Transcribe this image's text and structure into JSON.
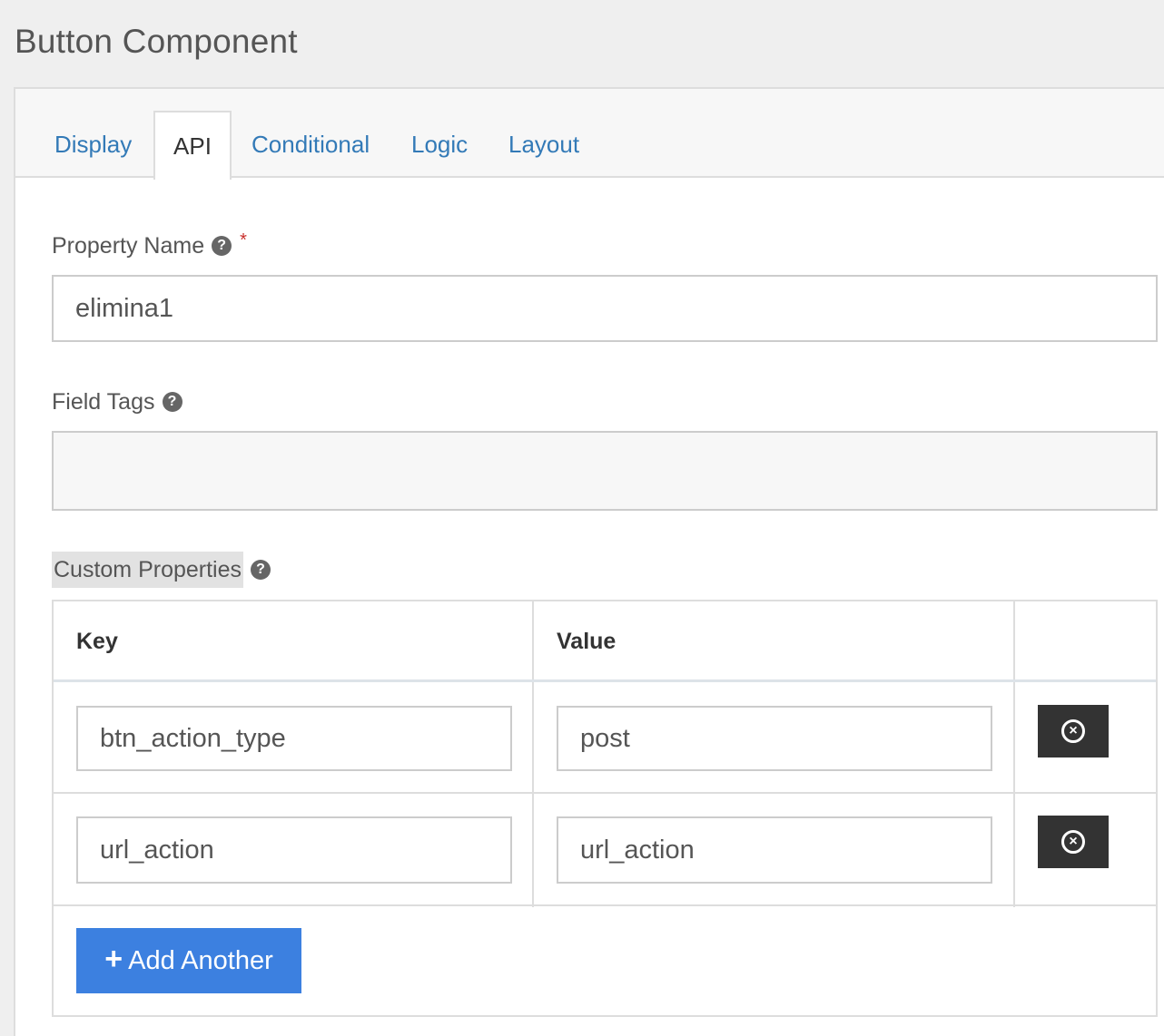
{
  "header": {
    "title": "Button Component"
  },
  "tabs": [
    {
      "label": "Display"
    },
    {
      "label": "API"
    },
    {
      "label": "Conditional"
    },
    {
      "label": "Logic"
    },
    {
      "label": "Layout"
    }
  ],
  "form": {
    "property_name": {
      "label": "Property Name",
      "required_marker": "*",
      "value": "elimina1"
    },
    "field_tags": {
      "label": "Field Tags",
      "value": ""
    },
    "custom_properties": {
      "label": "Custom Properties",
      "headers": {
        "key": "Key",
        "value": "Value"
      },
      "rows": [
        {
          "key": "btn_action_type",
          "value": "post"
        },
        {
          "key": "url_action",
          "value": "url_action"
        }
      ],
      "add_label": "Add Another"
    }
  },
  "icons": {
    "help": "question-circle-icon",
    "remove": "times-circle-icon",
    "add": "plus-icon"
  },
  "colors": {
    "link": "#337ab7",
    "primary": "#3c80e0",
    "danger_star": "#c9302c",
    "dark_button": "#333333"
  }
}
